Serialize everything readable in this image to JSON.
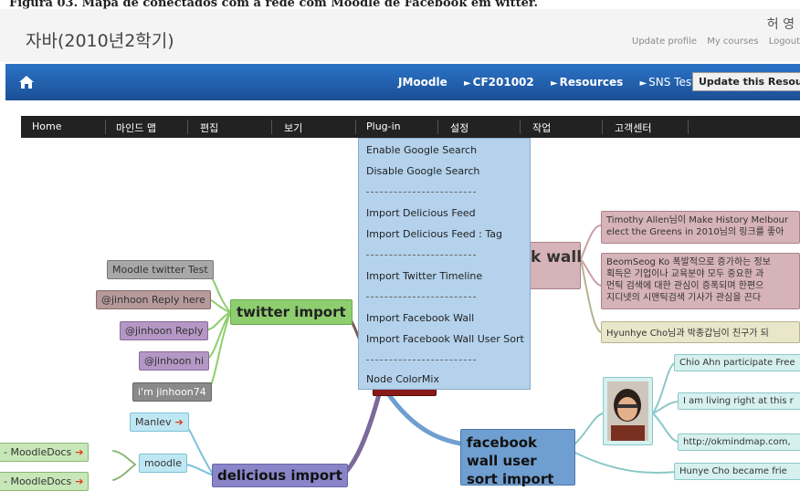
{
  "caption": "Figura 03. Mapa de conectados com a rede com Moodle de Facebook em witter.",
  "header": {
    "course_title": "자바(2010년2학기)",
    "user_name": "허 영",
    "links": [
      "Update profile",
      "My courses",
      "Logout"
    ]
  },
  "navbar": {
    "crumbs": [
      "JMoodle",
      "CF201002",
      "Resources",
      "SNS Test"
    ],
    "update_button": "Update this Resource"
  },
  "menubar": {
    "items": [
      "Home",
      "마인드 맵",
      "편집",
      "보기",
      "Plug-in",
      "설정",
      "작업",
      "고객센터"
    ]
  },
  "dropdown": {
    "items": [
      "Enable Google Search",
      "Disable Google Search",
      "Import Delicious Feed",
      "Import Delicious Feed : Tag",
      "Import Twitter Timeline",
      "Import Facebook Wall",
      "Import Facebook Wall User Sort",
      "Node ColorMix"
    ]
  },
  "mindmap": {
    "twitter_import": "twitter import",
    "twitter_children": [
      "Moodle twitter Test",
      "@jinhoon Reply here",
      "@jinhoon Reply",
      "@jinhoon hi",
      "i'm jinhoon74"
    ],
    "delicious_import": "delicious import",
    "delicious_children": [
      "Manlev",
      "moodle",
      "- MoodleDocs",
      "- MoodleDocs"
    ],
    "facebook_wall_title": "k wall",
    "facebook_wall_posts": [
      "Timothy Allen님이 Make History Melbour\nelect the Greens in 2010님의 링크를 좋아",
      "BeomSeog Ko 폭발적으로 증가하는 정보\n획득은 기업이나 교육분야 모두 중요한 과\n먼틱 검색에 대한 관심이 증폭되며 한편으\n지디넷의 시맨틱검색 기사가 관심을 끈다",
      "Hyunhye Cho님과 박종갑님이 친구가 되"
    ],
    "facebook_user_sort": "facebook wall user sort import",
    "facebook_user_posts": [
      "Chio Ahn participate Free",
      "I am living right at this r",
      "http://okmindmap.com,",
      "Hunye Cho became frie"
    ]
  }
}
